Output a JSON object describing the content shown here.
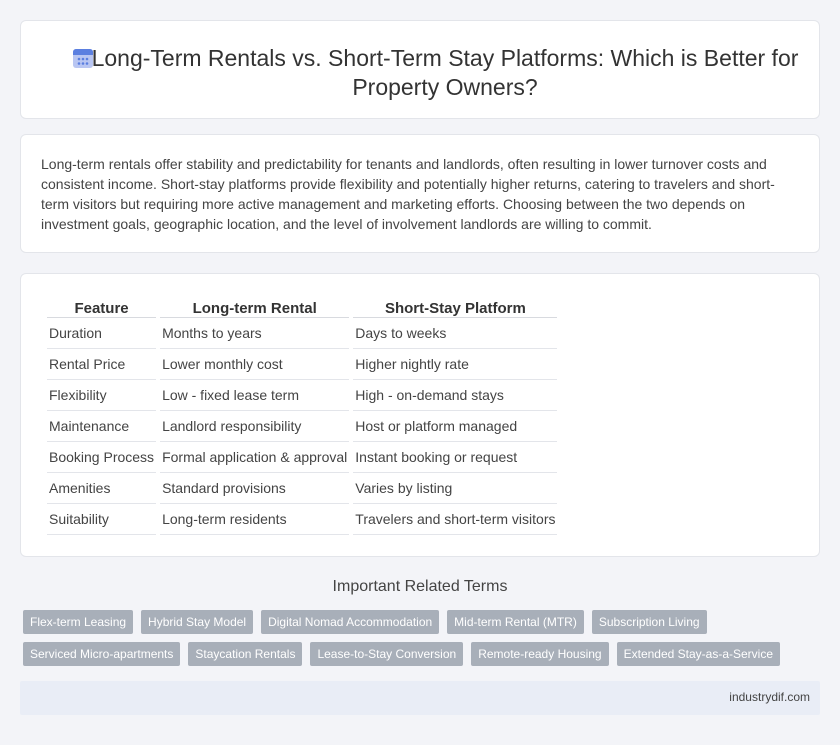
{
  "header": {
    "icon": "calendar-icon",
    "title": "Long-Term Rentals vs. Short-Term Stay Platforms: Which is Better for Property Owners?"
  },
  "intro": {
    "text": "Long-term rentals offer stability and predictability for tenants and landlords, often resulting in lower turnover costs and consistent income. Short-stay platforms provide flexibility and potentially higher returns, catering to travelers and short-term visitors but requiring more active management and marketing efforts. Choosing between the two depends on investment goals, geographic location, and the level of involvement landlords are willing to commit."
  },
  "table": {
    "headers": [
      "Feature",
      "Long-term Rental",
      "Short-Stay Platform"
    ],
    "rows": [
      [
        "Duration",
        "Months to years",
        "Days to weeks"
      ],
      [
        "Rental Price",
        "Lower monthly cost",
        "Higher nightly rate"
      ],
      [
        "Flexibility",
        "Low - fixed lease term",
        "High - on-demand stays"
      ],
      [
        "Maintenance",
        "Landlord responsibility",
        "Host or platform managed"
      ],
      [
        "Booking Process",
        "Formal application & approval",
        "Instant booking or request"
      ],
      [
        "Amenities",
        "Standard provisions",
        "Varies by listing"
      ],
      [
        "Suitability",
        "Long-term residents",
        "Travelers and short-term visitors"
      ]
    ]
  },
  "related": {
    "title": "Important Related Terms",
    "tags": [
      "Flex-term Leasing",
      "Hybrid Stay Model",
      "Digital Nomad Accommodation",
      "Mid-term Rental (MTR)",
      "Subscription Living",
      "Serviced Micro-apartments",
      "Staycation Rentals",
      "Lease-to-Stay Conversion",
      "Remote-ready Housing",
      "Extended Stay-as-a-Service"
    ]
  },
  "footer": {
    "site": "industrydif.com"
  },
  "colors": {
    "background": "#f3f4f8",
    "tag": "#a8afb9",
    "icon_header": "#5b7fe0",
    "icon_body": "#b9c6f2",
    "footer": "#e9edf6"
  }
}
